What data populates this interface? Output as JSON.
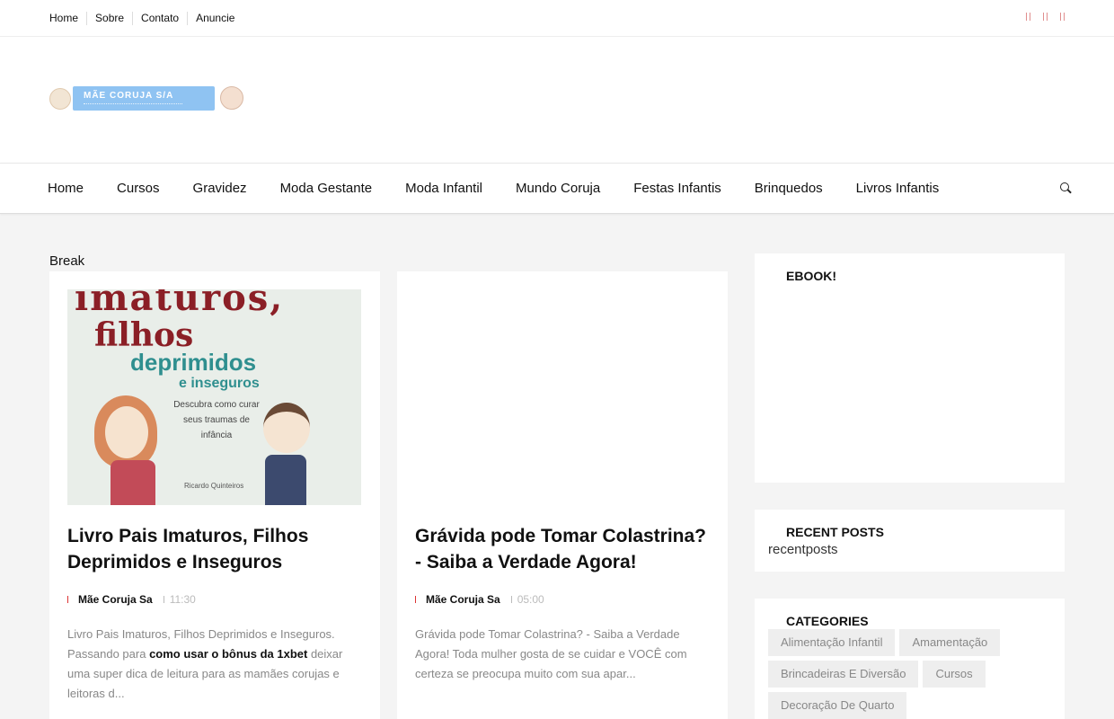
{
  "topnav": [
    "Home",
    "Sobre",
    "Contato",
    "Anuncie"
  ],
  "logo": {
    "text": "MÃE CORUJA S/A"
  },
  "mainnav": [
    "Home",
    "Cursos",
    "Gravidez",
    "Moda Gestante",
    "Moda Infantil",
    "Mundo Coruja",
    "Festas Infantis",
    "Brinquedos",
    "Livros Infantis"
  ],
  "break_label": "Break",
  "posts": [
    {
      "title": "Livro Pais Imaturos, Filhos Deprimidos e Inseguros",
      "author": "Mãe Coruja Sa",
      "time": "11:30",
      "excerpt_before": "Livro Pais Imaturos, Filhos Deprimidos e Inseguros. Passando para ",
      "excerpt_link": "como usar o bônus da 1xbet",
      "excerpt_after": " deixar uma super dica de leitura para as mamães corujas e leitoras d...",
      "cover": {
        "line1": "imaturos,",
        "line2": "filhos",
        "line3": "deprimidos",
        "line4": "e inseguros",
        "subtitle": "Descubra como curar seus traumas de infância",
        "author": "Ricardo Quinteiros"
      }
    },
    {
      "title": "Grávida pode Tomar Colastrina? - Saiba a Verdade Agora!",
      "author": "Mãe Coruja Sa",
      "time": "05:00",
      "excerpt": "Grávida pode Tomar Colastrina? - Saiba a Verdade Agora! Toda mulher gosta de se cuidar e VOCÊ com certeza se preocupa muito com sua apar..."
    }
  ],
  "sidebar": {
    "ebook_title": "EBOOK!",
    "recent_title": "RECENT POSTS",
    "recent_text": "recentposts",
    "categories_title": "CATEGORIES",
    "categories": [
      "Alimentação Infantil",
      "Amamentação",
      "Brincadeiras E Diversão",
      "Cursos",
      "Decoração De Quarto"
    ]
  },
  "colors": {
    "accent": "#d33",
    "logo_banner": "#8fc3f2",
    "background": "#f4f4f4"
  }
}
